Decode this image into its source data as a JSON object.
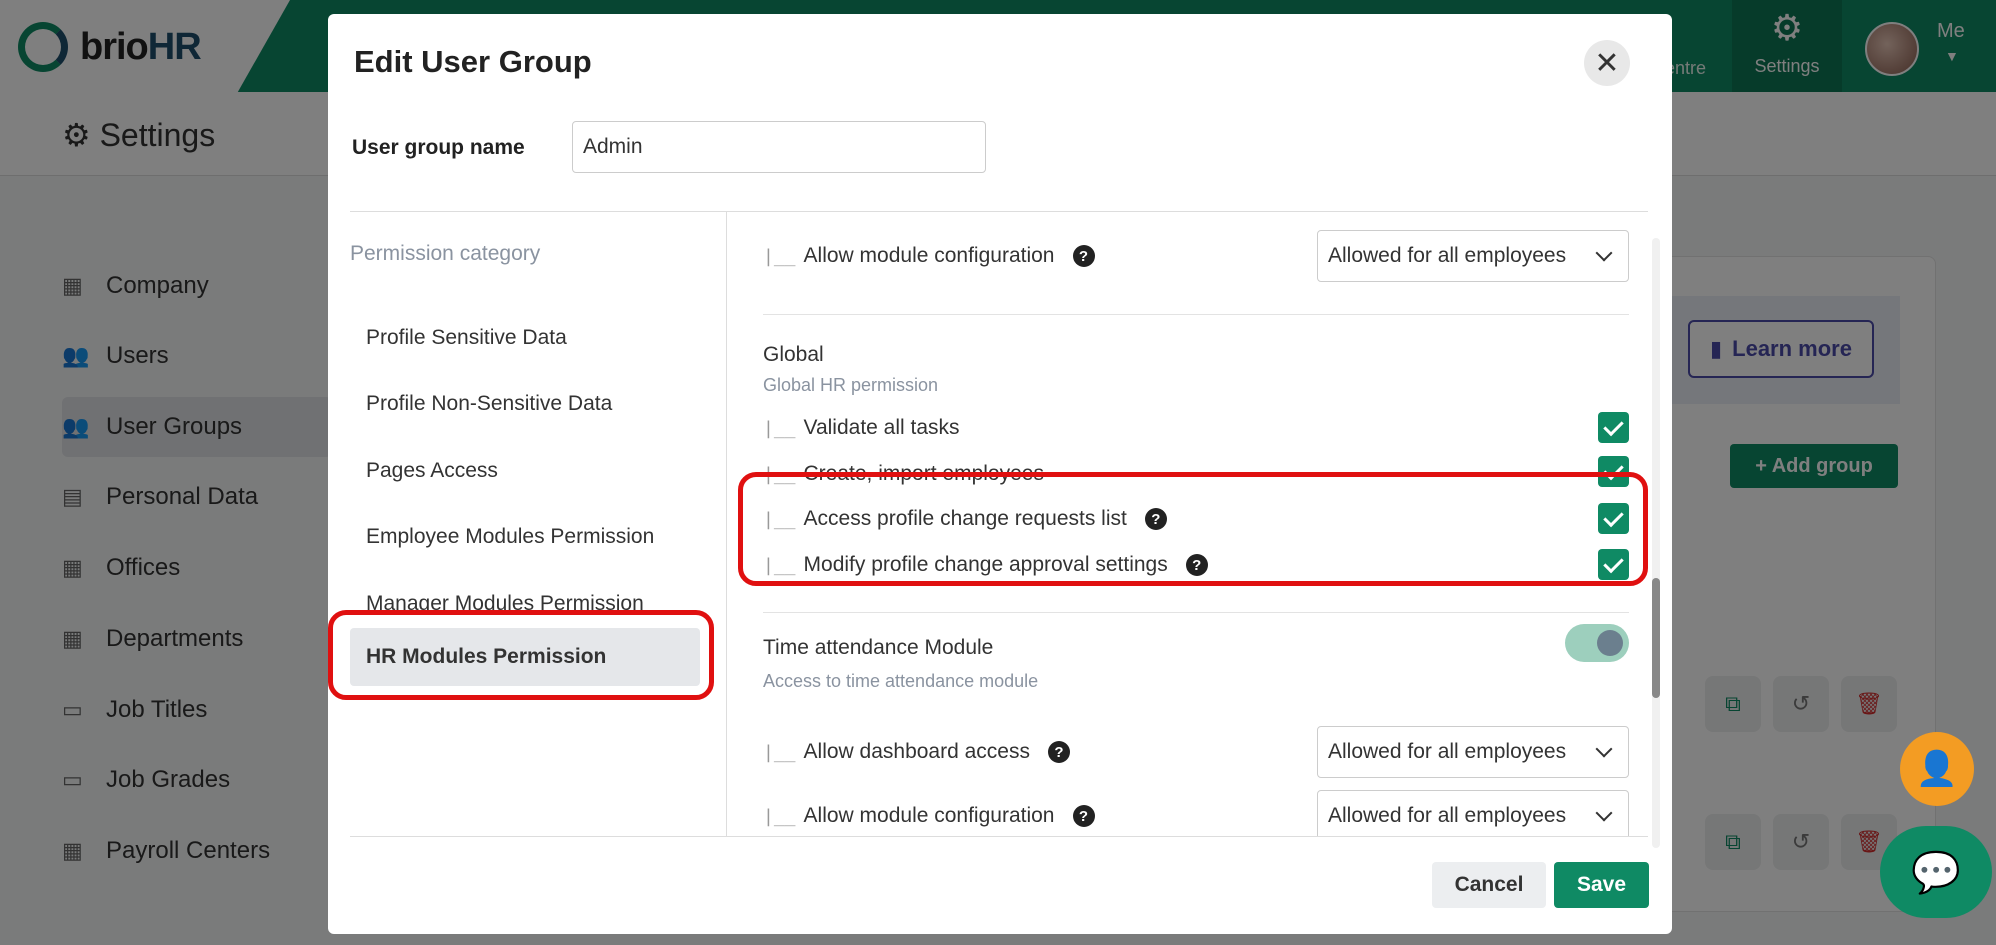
{
  "app": {
    "logo_text_a": "brio",
    "logo_text_b": "HR",
    "nav_partial": "entre",
    "nav_settings": "Settings",
    "nav_me": "Me",
    "page_title": "Settings"
  },
  "sidebar": {
    "items": [
      {
        "label": "Company",
        "icon": "building-icon"
      },
      {
        "label": "Users",
        "icon": "users-icon"
      },
      {
        "label": "User Groups",
        "icon": "users-icon",
        "active": true
      },
      {
        "label": "Personal Data",
        "icon": "id-card-icon"
      },
      {
        "label": "Offices",
        "icon": "building-icon"
      },
      {
        "label": "Departments",
        "icon": "building-icon"
      },
      {
        "label": "Job Titles",
        "icon": "briefcase-icon"
      },
      {
        "label": "Job Grades",
        "icon": "briefcase-icon"
      },
      {
        "label": "Payroll Centers",
        "icon": "building-icon"
      }
    ]
  },
  "background": {
    "learn_more": "Learn more",
    "add_group": "+ Add group"
  },
  "modal": {
    "title": "Edit User Group",
    "name_label": "User group name",
    "name_value": "Admin",
    "category_header": "Permission category",
    "categories": [
      "Profile Sensitive Data",
      "Profile Non-Sensitive Data",
      "Pages Access",
      "Employee Modules Permission",
      "Manager Modules Permission",
      "HR Modules Permission"
    ],
    "active_category": "HR Modules Permission",
    "perms": {
      "top_config_label": "Allow module configuration",
      "top_config_value": "Allowed for all employees",
      "global_title": "Global",
      "global_sub": "Global HR permission",
      "validate_tasks": "Validate all tasks",
      "create_import": "Create, import employees",
      "access_requests": "Access profile change requests list",
      "modify_approval": "Modify profile change approval settings",
      "time_title": "Time attendance Module",
      "time_sub": "Access to time attendance module",
      "dashboard_label": "Allow dashboard access",
      "dashboard_value": "Allowed for all employees",
      "config_label": "Allow module configuration",
      "config_value": "Allowed for all employees"
    },
    "tree_glyph": "|__",
    "help_glyph": "?",
    "cancel": "Cancel",
    "save": "Save"
  },
  "colors": {
    "brand": "#0f8a64",
    "highlight": "#e01010"
  }
}
